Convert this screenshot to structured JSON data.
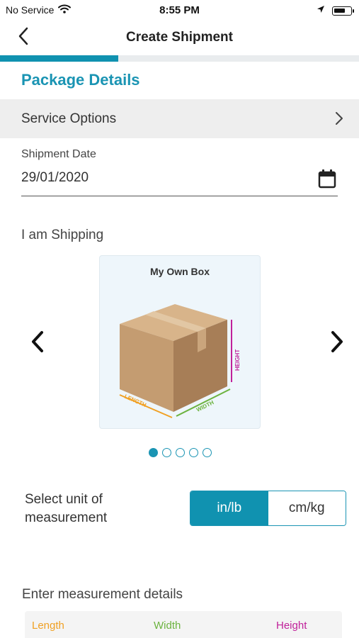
{
  "status_bar": {
    "carrier": "No Service",
    "time": "8:55 PM",
    "wifi_icon": "wifi-icon",
    "location_icon": "location-arrow-icon",
    "battery_icon": "battery-icon",
    "battery_level": 0.7
  },
  "nav": {
    "title": "Create Shipment",
    "back_icon": "chevron-left-icon"
  },
  "progress": {
    "value": 0.33,
    "color": "#1092b0"
  },
  "package": {
    "section_title": "Package Details",
    "service_options_label": "Service Options",
    "shipment_date_label": "Shipment Date",
    "shipment_date_value": "29/01/2020",
    "shipping_label": "I am Shipping"
  },
  "carousel": {
    "selected_title": "My Own Box",
    "dimension_labels": {
      "length": "LENGTH",
      "width": "WIDTH",
      "height": "HEIGHT"
    },
    "page_count": 5,
    "active_index": 0
  },
  "units": {
    "label": "Select unit of measurement",
    "options": [
      "in/lb",
      "cm/kg"
    ],
    "selected": "in/lb"
  },
  "measurements": {
    "label": "Enter measurement details",
    "columns": [
      "Length",
      "Width",
      "Height"
    ]
  },
  "colors": {
    "accent": "#1a94b3",
    "length": "#f0a023",
    "width": "#6cb33f",
    "height": "#c0219a"
  }
}
